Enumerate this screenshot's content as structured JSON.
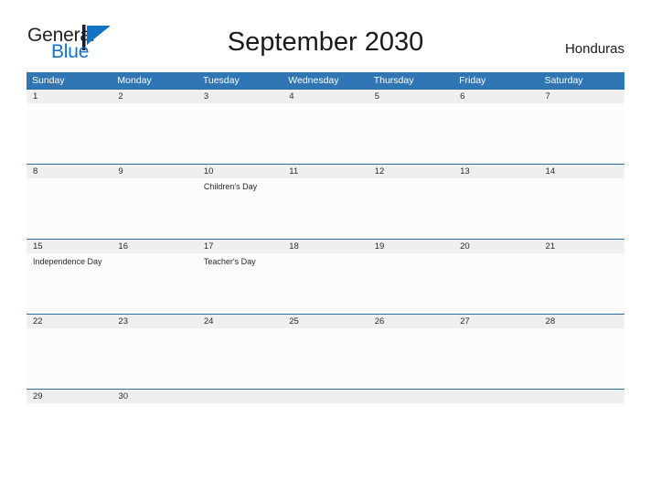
{
  "brand": {
    "name_part1": "General",
    "name_part2": "Blue",
    "flag_icon": "blue-triangle-flag-icon",
    "colors": {
      "general_text": "#222222",
      "blue_text": "#1273c4",
      "flag": "#1273c4"
    }
  },
  "header": {
    "title": "September 2030",
    "country": "Honduras"
  },
  "calendar": {
    "colors": {
      "header_bg": "#3075b4",
      "header_text": "#ffffff",
      "day_band_bg": "#efefef",
      "cell_bg": "#fcfcfc",
      "row_divider": "#2e6da4"
    },
    "weekdays": [
      "Sunday",
      "Monday",
      "Tuesday",
      "Wednesday",
      "Thursday",
      "Friday",
      "Saturday"
    ],
    "weeks": [
      {
        "days": [
          {
            "number": "1",
            "event": ""
          },
          {
            "number": "2",
            "event": ""
          },
          {
            "number": "3",
            "event": ""
          },
          {
            "number": "4",
            "event": ""
          },
          {
            "number": "5",
            "event": ""
          },
          {
            "number": "6",
            "event": ""
          },
          {
            "number": "7",
            "event": ""
          }
        ]
      },
      {
        "days": [
          {
            "number": "8",
            "event": ""
          },
          {
            "number": "9",
            "event": ""
          },
          {
            "number": "10",
            "event": "Children's Day"
          },
          {
            "number": "11",
            "event": ""
          },
          {
            "number": "12",
            "event": ""
          },
          {
            "number": "13",
            "event": ""
          },
          {
            "number": "14",
            "event": ""
          }
        ]
      },
      {
        "days": [
          {
            "number": "15",
            "event": "Independence Day"
          },
          {
            "number": "16",
            "event": ""
          },
          {
            "number": "17",
            "event": "Teacher's Day"
          },
          {
            "number": "18",
            "event": ""
          },
          {
            "number": "19",
            "event": ""
          },
          {
            "number": "20",
            "event": ""
          },
          {
            "number": "21",
            "event": ""
          }
        ]
      },
      {
        "days": [
          {
            "number": "22",
            "event": ""
          },
          {
            "number": "23",
            "event": ""
          },
          {
            "number": "24",
            "event": ""
          },
          {
            "number": "25",
            "event": ""
          },
          {
            "number": "26",
            "event": ""
          },
          {
            "number": "27",
            "event": ""
          },
          {
            "number": "28",
            "event": ""
          }
        ]
      },
      {
        "days": [
          {
            "number": "29",
            "event": ""
          },
          {
            "number": "30",
            "event": ""
          },
          {
            "number": "",
            "event": ""
          },
          {
            "number": "",
            "event": ""
          },
          {
            "number": "",
            "event": ""
          },
          {
            "number": "",
            "event": ""
          },
          {
            "number": "",
            "event": ""
          }
        ]
      }
    ]
  }
}
